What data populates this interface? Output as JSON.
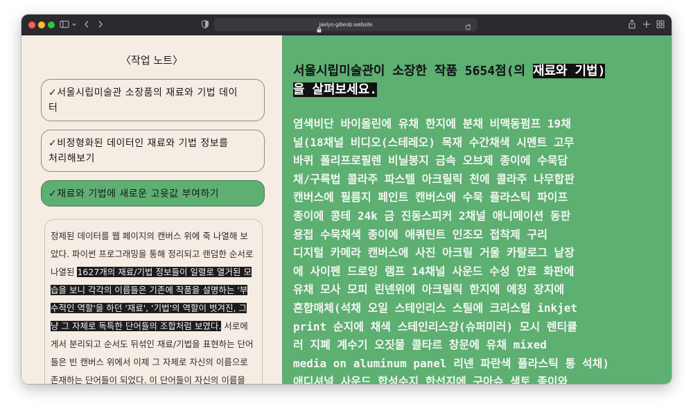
{
  "browser": {
    "url": "jaelyo-gibeob.website"
  },
  "notes": {
    "title": "〈작업 노트〉",
    "items": [
      {
        "line1": "✓서울시립미술관 소장품의 재료와 기법 데이",
        "line2": "터"
      },
      {
        "line1": "✓비정형화된 데이터인 재료와 기법 정보를",
        "line2": "처리해보기"
      },
      {
        "line1": "✓재료와 기법에 새로운 고윳값 부여하기",
        "line2": ""
      }
    ]
  },
  "paragraph": {
    "l1": "정제된 데이터를 웹 페이지의 캔버스 위에 죽 나열해 보",
    "l2": "았다. 파이썬 프로그래밍을 통해 정리되고 랜덤한 순서로",
    "l3a": "나열된 ",
    "l3b": "1627개의 재료/기법 정보들이 일렬로 열거된 모",
    "l4": "습을 보니 각각의 이름들은 기존에 작품을 설명하는 '부",
    "l5": "수적인 역할'을 하던 '재료', '기법'의 역할이 벗겨진, 그",
    "l6a": "냥 그 자체로 독특한 단어들의 조합처럼 보였다.",
    "l6b": " 서로에",
    "l7": "게서 분리되고 순서도 뒤섞인 재료/기법을 표현하는 단어",
    "l8": "들은 빈 캔버스 위에서 이제 그 자체로 자신의 이름으로",
    "l9": "존재하는 단어들이 되었다. 이 단어들이 자신의 이름을"
  },
  "main": {
    "heading_l1a": "서울시립미술관이 소장한 작품 5654점(의 ",
    "heading_l1b": "재료와 기법)",
    "heading_l2": "을 살펴보세요.",
    "words": [
      " 염색비단  바이올린에 유채  한지에 분채  비맥동펌프  19채",
      "널(18채널 비디오(스테레오)  목재  수간채색  시멘트  고무",
      "바퀴  폴리프로필렌  비닐봉지  금속 오브제  종이에 수묵담",
      "채/구륵법  콜라주  파스텔 아크릴릭  천에 콜라주  나무합판",
      " 캔버스에 필름지  페인트  캔버스에 수묵  플라스틱 파이프",
      " 종이에 콩테  24k 금  진동스피커  2채널 애니메이션  동판",
      "용접  수묵채색  종이에 애쿼틴트  인조모  접착제  구리",
      " 디지털 카메라  캔버스에 사진  아크릴 거울  카탈로그 낱장",
      "에 사이펜 드로잉  램프  14채널 사운드  수성 안료  화판에",
      "유채  모사  모피  린넨위에 아크릴릭  한지에 에칭  장지에",
      "혼합매체(석채  오일  스테인리스 스틸에 크리스털  inkjet",
      "print  순지에 채색  스테인리스강(슈퍼미러)  모시  렌티큘",
      "러  지폐 계수기  오짓물  콜타르  창문에 유채  mixed",
      "media on aluminum panel  리넨  파란색 플라스틱 통  석채)",
      " 애디셔널 사운드  합성수지  한선지에 구아슈  색토  종이와"
    ]
  }
}
